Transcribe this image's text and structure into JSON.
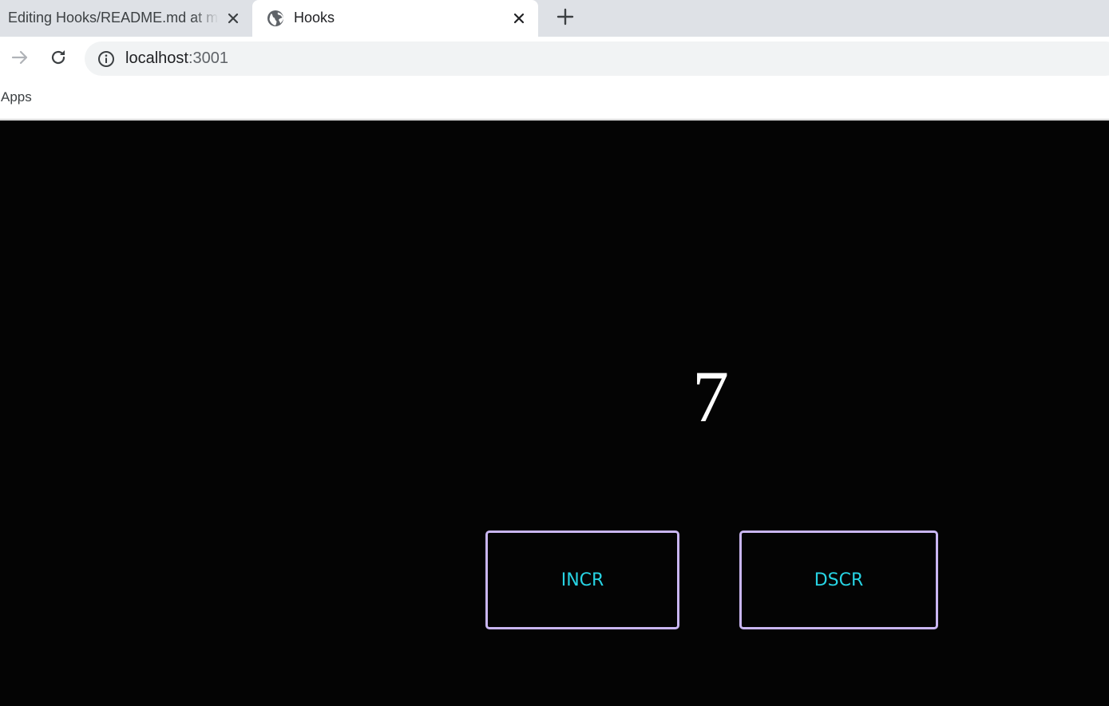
{
  "browser": {
    "tabs": [
      {
        "title": "Editing Hooks/README.md at main",
        "active": false,
        "close_icon": "close-icon"
      },
      {
        "title": "Hooks",
        "active": true,
        "favicon": "globe-icon",
        "close_icon": "close-icon"
      }
    ],
    "new_tab_icon": "plus-icon",
    "toolbar": {
      "back_icon": "arrow-right-icon",
      "reload_icon": "reload-icon",
      "site_info_icon": "info-icon",
      "url_host": "localhost",
      "url_port": ":3001"
    },
    "bookmarks": {
      "apps_label": "Apps"
    }
  },
  "page": {
    "background": "#040404",
    "counter_value": "7",
    "buttons": {
      "incr_label": "INCR",
      "dscr_label": "DSCR",
      "border_color": "#c9b6f2",
      "text_color": "#27d3e3"
    }
  }
}
